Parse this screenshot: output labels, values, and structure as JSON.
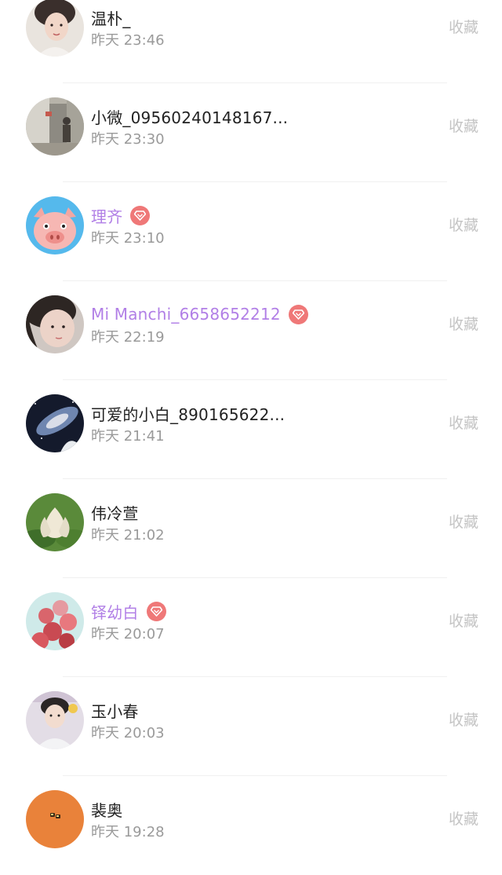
{
  "colors": {
    "vip_name": "#b17fe6",
    "vip_badge": "#ef7878",
    "time_text": "#9a9a9a",
    "action_text": "#c4c4c4"
  },
  "visitors": [
    {
      "name": "温朴_",
      "time": "昨天 23:46",
      "vip": false,
      "action": "收藏",
      "avatar": "avatar-woman-portrait"
    },
    {
      "name": "小微_09560240148167...",
      "time": "昨天 23:30",
      "vip": false,
      "action": "收藏",
      "avatar": "avatar-street-photo"
    },
    {
      "name": "理齐",
      "time": "昨天 23:10",
      "vip": true,
      "action": "收藏",
      "avatar": "avatar-pig-cartoon"
    },
    {
      "name": "Mi Manchi_6658652212",
      "time": "昨天 22:19",
      "vip": true,
      "action": "收藏",
      "avatar": "avatar-girl-face"
    },
    {
      "name": "可爱的小白_890165622...",
      "time": "昨天 21:41",
      "vip": false,
      "action": "收藏",
      "avatar": "avatar-galaxy"
    },
    {
      "name": "伟冷萱",
      "time": "昨天 21:02",
      "vip": false,
      "action": "收藏",
      "avatar": "avatar-lotus-flower"
    },
    {
      "name": "铎幼白",
      "time": "昨天 20:07",
      "vip": true,
      "action": "收藏",
      "avatar": "avatar-balloons"
    },
    {
      "name": "玉小春",
      "time": "昨天 20:03",
      "vip": false,
      "action": "收藏",
      "avatar": "avatar-boy-portrait"
    },
    {
      "name": "裴奥",
      "time": "昨天 19:28",
      "vip": false,
      "action": "收藏",
      "avatar": "avatar-orange-sticker"
    }
  ]
}
